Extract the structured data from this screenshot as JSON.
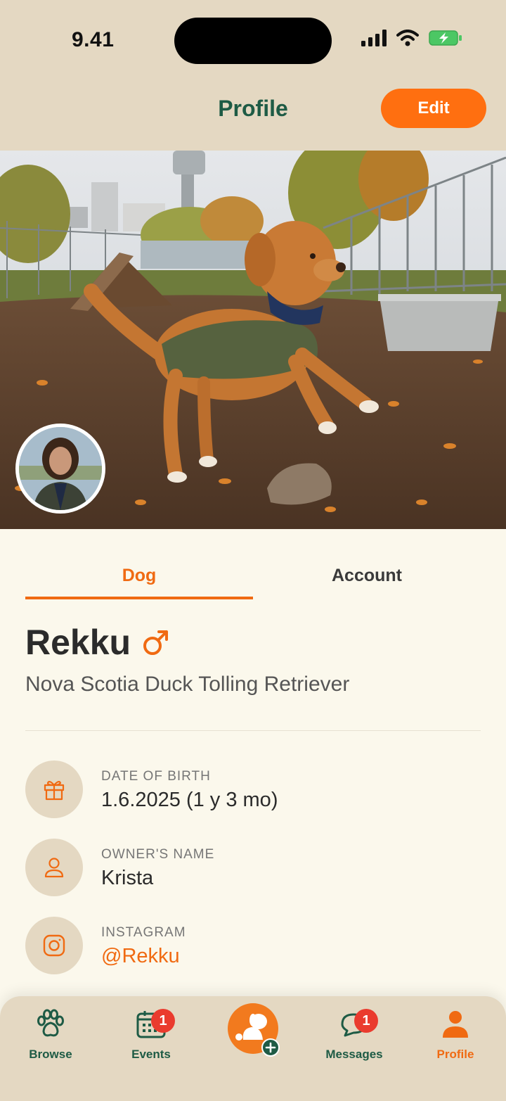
{
  "status_bar": {
    "time": "9.41"
  },
  "header": {
    "title": "Profile",
    "edit_label": "Edit"
  },
  "tabs": [
    {
      "label": "Dog",
      "active": true
    },
    {
      "label": "Account",
      "active": false
    }
  ],
  "dog": {
    "name": "Rekku",
    "gender_icon": "male-symbol-icon",
    "breed": "Nova Scotia Duck Tolling Retriever"
  },
  "info": [
    {
      "icon": "gift-icon",
      "label": "DATE OF BIRTH",
      "value": "1.6.2025 (1 y 3 mo)"
    },
    {
      "icon": "person-icon",
      "label": "OWNER'S NAME",
      "value": "Krista"
    },
    {
      "icon": "instagram-icon",
      "label": "INSTAGRAM",
      "value": "@Rekku"
    }
  ],
  "nav": [
    {
      "label": "Browse",
      "icon": "paw-icon"
    },
    {
      "label": "Events",
      "icon": "calendar-icon",
      "badge": "1"
    },
    {
      "label": "",
      "icon": "add-dog-icon"
    },
    {
      "label": "Messages",
      "icon": "chat-icon",
      "badge": "1"
    },
    {
      "label": "Profile",
      "icon": "person-icon",
      "active": true
    }
  ],
  "colors": {
    "accent": "#F06A12",
    "header_bg": "#E4D8C2",
    "brand_green": "#1E5B45",
    "page_bg": "#FBF8EC",
    "badge_red": "#EA3B2E"
  }
}
